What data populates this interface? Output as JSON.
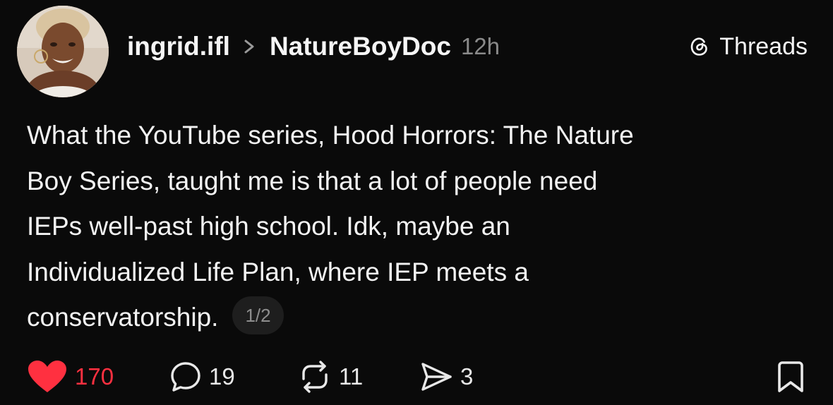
{
  "post": {
    "author": "ingrid.ifl",
    "reply_to": "NatureBoyDoc",
    "time": "12h",
    "brand": "Threads",
    "text_lines": [
      "What the YouTube series, Hood Horrors: The Nature",
      "Boy Series, taught me is that a lot of people need",
      "IEPs well-past high school. Idk, maybe an",
      "Individualized Life Plan, where IEP meets a",
      "conservatorship."
    ],
    "page_indicator": "1/2"
  },
  "actions": {
    "likes": "170",
    "comments": "19",
    "reposts": "11",
    "shares": "3"
  },
  "colors": {
    "background": "#0a0a0a",
    "like_red": "#ff3040",
    "muted_text": "#8a8a8a"
  },
  "icons": {
    "like": "heart-icon",
    "comment": "speech-bubble-icon",
    "repost": "repost-arrows-icon",
    "share": "paper-plane-icon",
    "bookmark": "bookmark-icon",
    "brand": "threads-logo-icon",
    "separator": "chevron-right-icon"
  }
}
